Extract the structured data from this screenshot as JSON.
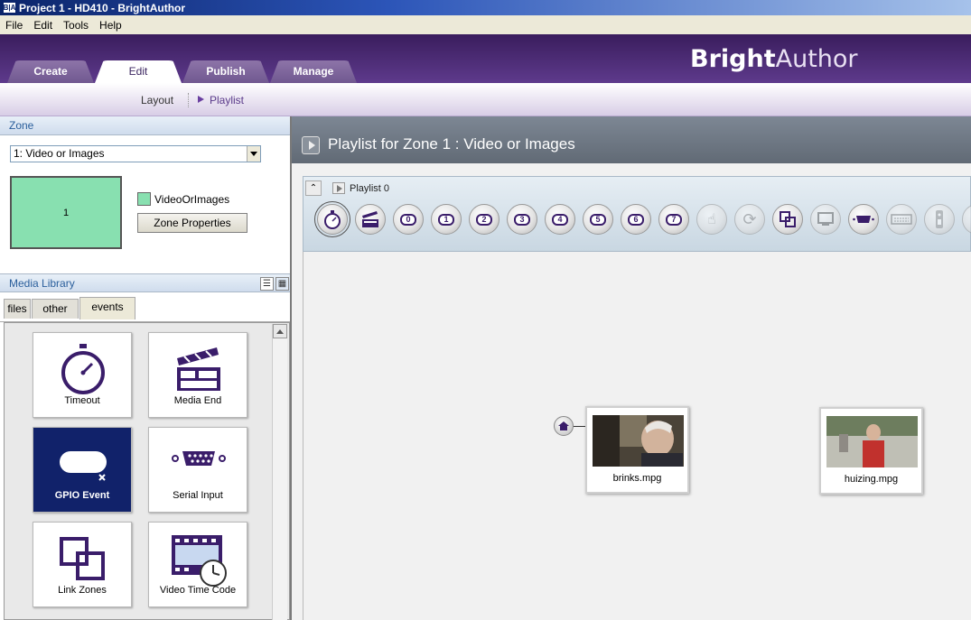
{
  "window": {
    "title": "Project 1 - HD410 - BrightAuthor",
    "icon": "B|A"
  },
  "menu": [
    "File",
    "Edit",
    "Tools",
    "Help"
  ],
  "brand": {
    "bold": "Bright",
    "light": "Author"
  },
  "tabs": [
    "Create",
    "Edit",
    "Publish",
    "Manage"
  ],
  "active_tab": "Edit",
  "subnav": {
    "layout": "Layout",
    "playlist": "Playlist"
  },
  "zone": {
    "header": "Zone",
    "selected": "1: Video or Images",
    "preview_number": "1",
    "name": "VideoOrImages",
    "properties_button": "Zone Properties"
  },
  "media_library": {
    "header": "Media Library",
    "tabs": [
      "files",
      "other",
      "events"
    ],
    "active_tab": "events",
    "items": [
      {
        "label": "Timeout",
        "icon": "stopwatch-icon"
      },
      {
        "label": "Media End",
        "icon": "clapperboard-icon"
      },
      {
        "label": "GPIO Event",
        "icon": "gpio-button-icon",
        "selected": true
      },
      {
        "label": "Serial Input",
        "icon": "serial-port-icon"
      },
      {
        "label": "Link Zones",
        "icon": "link-zones-icon"
      },
      {
        "label": "Video Time Code",
        "icon": "video-timecode-icon"
      }
    ]
  },
  "playlist": {
    "header": "Playlist for Zone 1 : Video or Images",
    "name": "Playlist 0",
    "toolbar": [
      "timeout",
      "media-end",
      "0",
      "1",
      "2",
      "3",
      "4",
      "5",
      "6",
      "7",
      "touch",
      "refresh",
      "link-zones",
      "monitor",
      "serial",
      "keyboard",
      "remote",
      "more"
    ]
  },
  "canvas": {
    "items": [
      {
        "label": "brinks.mpg",
        "thumbnail": "older-man-video-thumbnail"
      },
      {
        "label": "huizing.mpg",
        "thumbnail": "man-street-video-thumbnail"
      }
    ]
  },
  "colors": {
    "header_purple": "#4a2a74",
    "zone_green": "#88e0b0",
    "selected_tile": "#11226a"
  }
}
